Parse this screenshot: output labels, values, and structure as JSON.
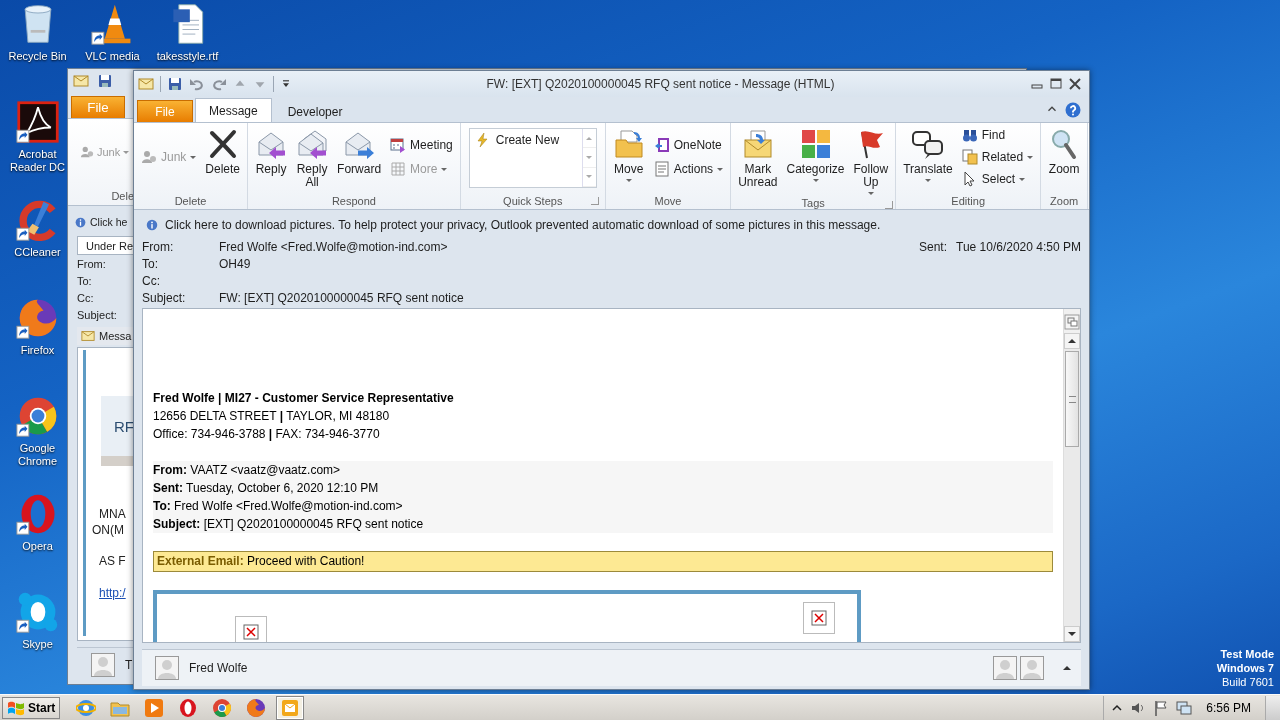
{
  "desktop": {
    "icons": [
      {
        "label": "Recycle Bin"
      },
      {
        "label": "VLC media"
      },
      {
        "label": "takesstyle.rtf"
      },
      {
        "label": "Acrobat Reader DC"
      },
      {
        "label": "CCleaner"
      },
      {
        "label": "Firefox"
      },
      {
        "label": "Google Chrome"
      },
      {
        "label": "Opera"
      },
      {
        "label": "Skype"
      }
    ]
  },
  "back_window": {
    "file_tab": "File",
    "junk": "Junk",
    "group_label": "Dele",
    "info": "Click he",
    "field_value": "Under Re",
    "header_labels": [
      "From:",
      "To:",
      "Cc:",
      "Subject:"
    ],
    "message_tab": "Messa",
    "banner": "RF",
    "lines": [
      "MNA",
      "ON(M",
      "AS F"
    ],
    "link": "http:/",
    "people": "T"
  },
  "window": {
    "title": "FW: [EXT] Q2020100000045 RFQ sent notice  -  Message (HTML)",
    "tabs": [
      {
        "label": "File",
        "kind": "file",
        "selected": false
      },
      {
        "label": "Message",
        "kind": "tab",
        "selected": true
      },
      {
        "label": "Developer",
        "kind": "tab",
        "selected": false
      }
    ],
    "ribbon": [
      {
        "label": "Delete",
        "kind": "buttons",
        "buttons": [
          {
            "label": "Junk",
            "kind": "small",
            "disabled": true,
            "dropdown": true
          },
          {
            "label": "Delete",
            "kind": "large",
            "disabled": false,
            "dropdown": false
          }
        ]
      },
      {
        "label": "Respond",
        "kind": "buttons",
        "buttons": [
          {
            "label": "Reply",
            "kind": "large",
            "disabled": false,
            "dropdown": false
          },
          {
            "label": "Reply All",
            "kind": "large",
            "disabled": false,
            "dropdown": false
          },
          {
            "label": "Forward",
            "kind": "large",
            "disabled": false,
            "dropdown": false
          },
          {
            "label": "Meeting",
            "kind": "small",
            "disabled": false,
            "dropdown": false
          },
          {
            "label": "More",
            "kind": "small",
            "disabled": true,
            "dropdown": true
          }
        ]
      },
      {
        "label": "Quick Steps",
        "kind": "gallery",
        "launcher": true,
        "items": [
          {
            "label": "Create New"
          }
        ]
      },
      {
        "label": "Move",
        "kind": "buttons",
        "buttons": [
          {
            "label": "Move",
            "kind": "large",
            "disabled": false,
            "dropdown": true
          },
          {
            "label": "OneNote",
            "kind": "small",
            "disabled": false,
            "dropdown": false
          },
          {
            "label": "Actions",
            "kind": "small",
            "disabled": false,
            "dropdown": true
          }
        ]
      },
      {
        "label": "Tags",
        "kind": "buttons",
        "launcher": true,
        "buttons": [
          {
            "label": "Mark Unread",
            "kind": "large",
            "disabled": false,
            "dropdown": false
          },
          {
            "label": "Categorize",
            "kind": "large",
            "disabled": false,
            "dropdown": true
          },
          {
            "label": "Follow Up",
            "kind": "large",
            "disabled": false,
            "dropdown": true
          }
        ]
      },
      {
        "label": "Editing",
        "kind": "buttons",
        "buttons": [
          {
            "label": "Translate",
            "kind": "large",
            "disabled": false,
            "dropdown": true
          },
          {
            "label": "Find",
            "kind": "small",
            "disabled": false,
            "dropdown": false
          },
          {
            "label": "Related",
            "kind": "small",
            "disabled": false,
            "dropdown": true
          },
          {
            "label": "Select",
            "kind": "small",
            "disabled": false,
            "dropdown": true
          }
        ]
      },
      {
        "label": "Zoom",
        "kind": "buttons",
        "buttons": [
          {
            "label": "Zoom",
            "kind": "large",
            "disabled": false,
            "dropdown": false
          }
        ]
      }
    ],
    "infobar": "Click here to download pictures. To help protect your privacy, Outlook prevented automatic download of some pictures in this message.",
    "header": {
      "fields": [
        {
          "label": "From:",
          "value": "Fred Wolfe <Fred.Wolfe@motion-ind.com>"
        },
        {
          "label": "To:",
          "value": "OH49"
        },
        {
          "label": "Cc:"
        },
        {
          "label": "Subject:",
          "value": "FW: [EXT] Q2020100000045 RFQ sent notice"
        }
      ],
      "sent": {
        "label": "Sent:",
        "value": "Tue 10/6/2020 4:50 PM"
      }
    },
    "body": {
      "signature": [
        {
          "text": "Fred Wolfe | MI27 - Customer Service Representative",
          "kind": "bold"
        },
        {
          "text": "12656 DELTA STREET **|** TAYLOR, MI 48180",
          "kind": "plain"
        },
        {
          "text": "Office: 734-946-3788 **|** FAX: 734-946-3770",
          "kind": "plain"
        }
      ],
      "forward_header": [
        "**From:** VAATZ <vaatz@vaatz.com>",
        "**Sent:** Tuesday, October 6, 2020 12:10 PM",
        "**To:** Fred Wolfe <Fred.Wolfe@motion-ind.com>",
        "**Subject:** [EXT] Q2020100000045 RFQ sent notice"
      ],
      "caution": "**External Email:** Proceed with Caution!"
    },
    "people": {
      "name": "Fred Wolfe"
    }
  },
  "system_note": [
    "Test Mode",
    "Windows 7",
    "Build 7601"
  ],
  "taskbar": {
    "start": "Start",
    "apps": [
      {
        "active": false
      },
      {
        "active": false
      },
      {
        "active": false
      },
      {
        "active": false
      },
      {
        "active": false
      },
      {
        "active": false
      },
      {
        "active": true
      }
    ],
    "clock": "6:56 PM"
  }
}
